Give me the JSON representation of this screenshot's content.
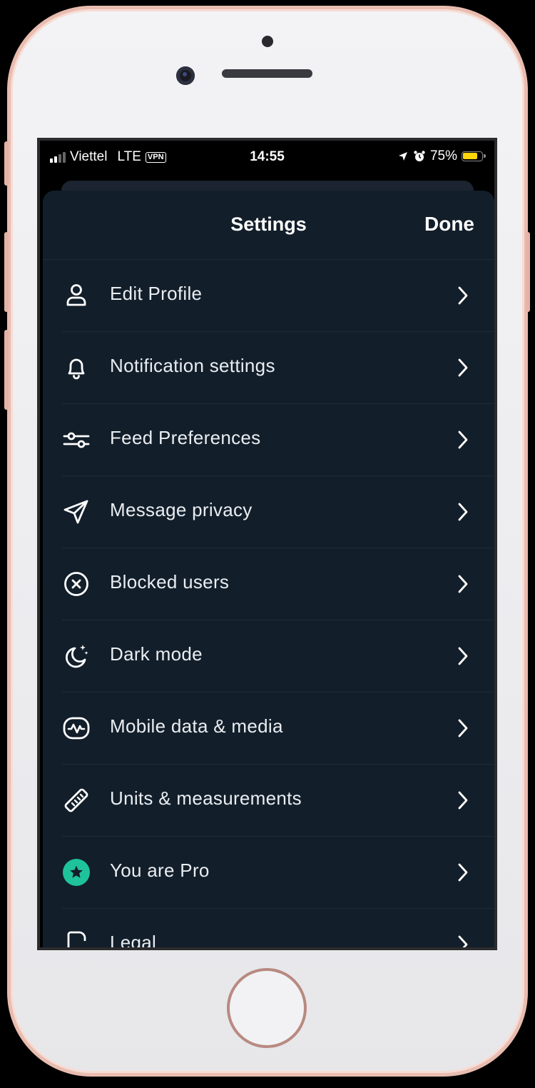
{
  "status_bar": {
    "carrier": "Viettel",
    "network": "LTE",
    "vpn": "VPN",
    "time": "14:55",
    "battery": "75%"
  },
  "header": {
    "title": "Settings",
    "done_label": "Done"
  },
  "settings_items": [
    {
      "label": "Edit Profile",
      "icon": "user-icon"
    },
    {
      "label": "Notification settings",
      "icon": "bell-icon"
    },
    {
      "label": "Feed Preferences",
      "icon": "sliders-icon"
    },
    {
      "label": "Message privacy",
      "icon": "send-icon"
    },
    {
      "label": "Blocked users",
      "icon": "circle-x-icon"
    },
    {
      "label": "Dark mode",
      "icon": "moon-stars-icon"
    },
    {
      "label": "Mobile data & media",
      "icon": "activity-icon"
    },
    {
      "label": "Units & measurements",
      "icon": "ruler-icon"
    },
    {
      "label": "You are Pro",
      "icon": "pro-star-icon"
    },
    {
      "label": "Legal",
      "icon": "document-icon"
    }
  ],
  "colors": {
    "background": "#121e2a",
    "text": "#e9edf1",
    "pro_badge": "#1ec39a",
    "battery": "#ffd60a"
  }
}
